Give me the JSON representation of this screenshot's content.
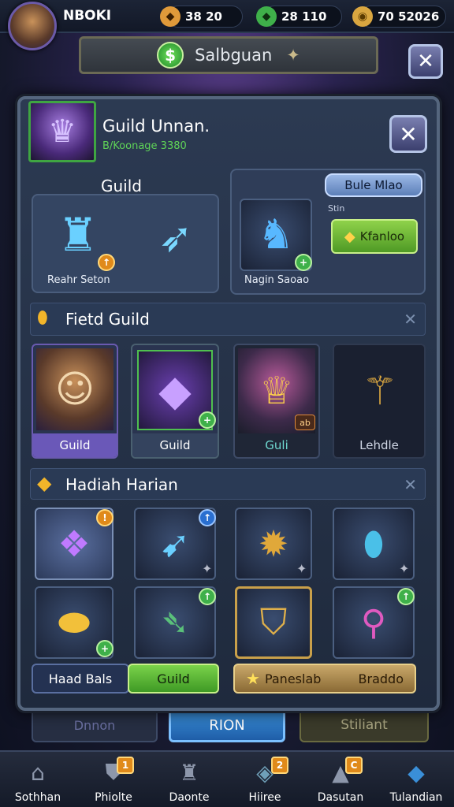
{
  "top_bar": {
    "player_name": "NBOKI",
    "resources": [
      {
        "icon": "amber-gem-icon",
        "value": "38 20",
        "color": "#e09a3a"
      },
      {
        "icon": "green-gem-icon",
        "value": "28 110",
        "color": "#3fb04a"
      },
      {
        "icon": "gold-coin-icon",
        "value": "70 52026",
        "color": "#d9a640"
      }
    ],
    "add_symbol": "+"
  },
  "banner": {
    "title": "Salbguan",
    "coin_symbol": "$"
  },
  "panel": {
    "header": {
      "title": "Guild Unnan.",
      "subtitle": "B/Koonage 3380"
    },
    "guild_box": {
      "title": "Guild",
      "items": [
        {
          "label": "Reahr Seton"
        }
      ]
    },
    "mage_box": {
      "tab_label": "Bule Mlao",
      "small_label": "Stin",
      "portrait_label": "Nagin Saoao",
      "action_label": "Kfanloo"
    },
    "field_guild": {
      "title": "Fietd Guild",
      "cards": [
        {
          "label": "Guild",
          "icon": "warrior-portrait-icon"
        },
        {
          "label": "Guild",
          "icon": "purple-crystal-icon"
        },
        {
          "label": "Guli",
          "icon": "valkyrie-portrait-icon",
          "badge": "ab"
        },
        {
          "label": "Lehdle",
          "icon": "golden-staff-icon"
        }
      ]
    },
    "daily_rewards": {
      "title": "Hadiah Harian",
      "row1": [
        {
          "icon": "purple-amulet-icon"
        },
        {
          "icon": "ice-arrow-icon"
        },
        {
          "icon": "sun-emblem-icon"
        },
        {
          "icon": "blue-orb-icon"
        }
      ],
      "row2": [
        {
          "icon": "gold-gem-icon"
        },
        {
          "icon": "green-bow-icon"
        },
        {
          "icon": "gold-shield-icon"
        },
        {
          "icon": "pink-potion-icon"
        }
      ]
    },
    "bottom_buttons": {
      "left": "Haad Bals",
      "right": "Guild",
      "wide": "Paneslab",
      "wide_right": "Braddo"
    }
  },
  "behind_row": {
    "left": "Dnnon",
    "center": "RION",
    "right": "Stiliant"
  },
  "nav": {
    "items": [
      {
        "label": "Sothhan",
        "icon": "home-icon"
      },
      {
        "label": "Phiolte",
        "icon": "shield-icon",
        "badge": "1"
      },
      {
        "label": "Daonte",
        "icon": "castle-icon"
      },
      {
        "label": "Hiiree",
        "icon": "gem-icon",
        "badge": "2"
      },
      {
        "label": "Dasutan",
        "icon": "mountain-icon",
        "badge": "C"
      },
      {
        "label": "Tulandian",
        "icon": "blue-crystal-icon"
      }
    ]
  }
}
